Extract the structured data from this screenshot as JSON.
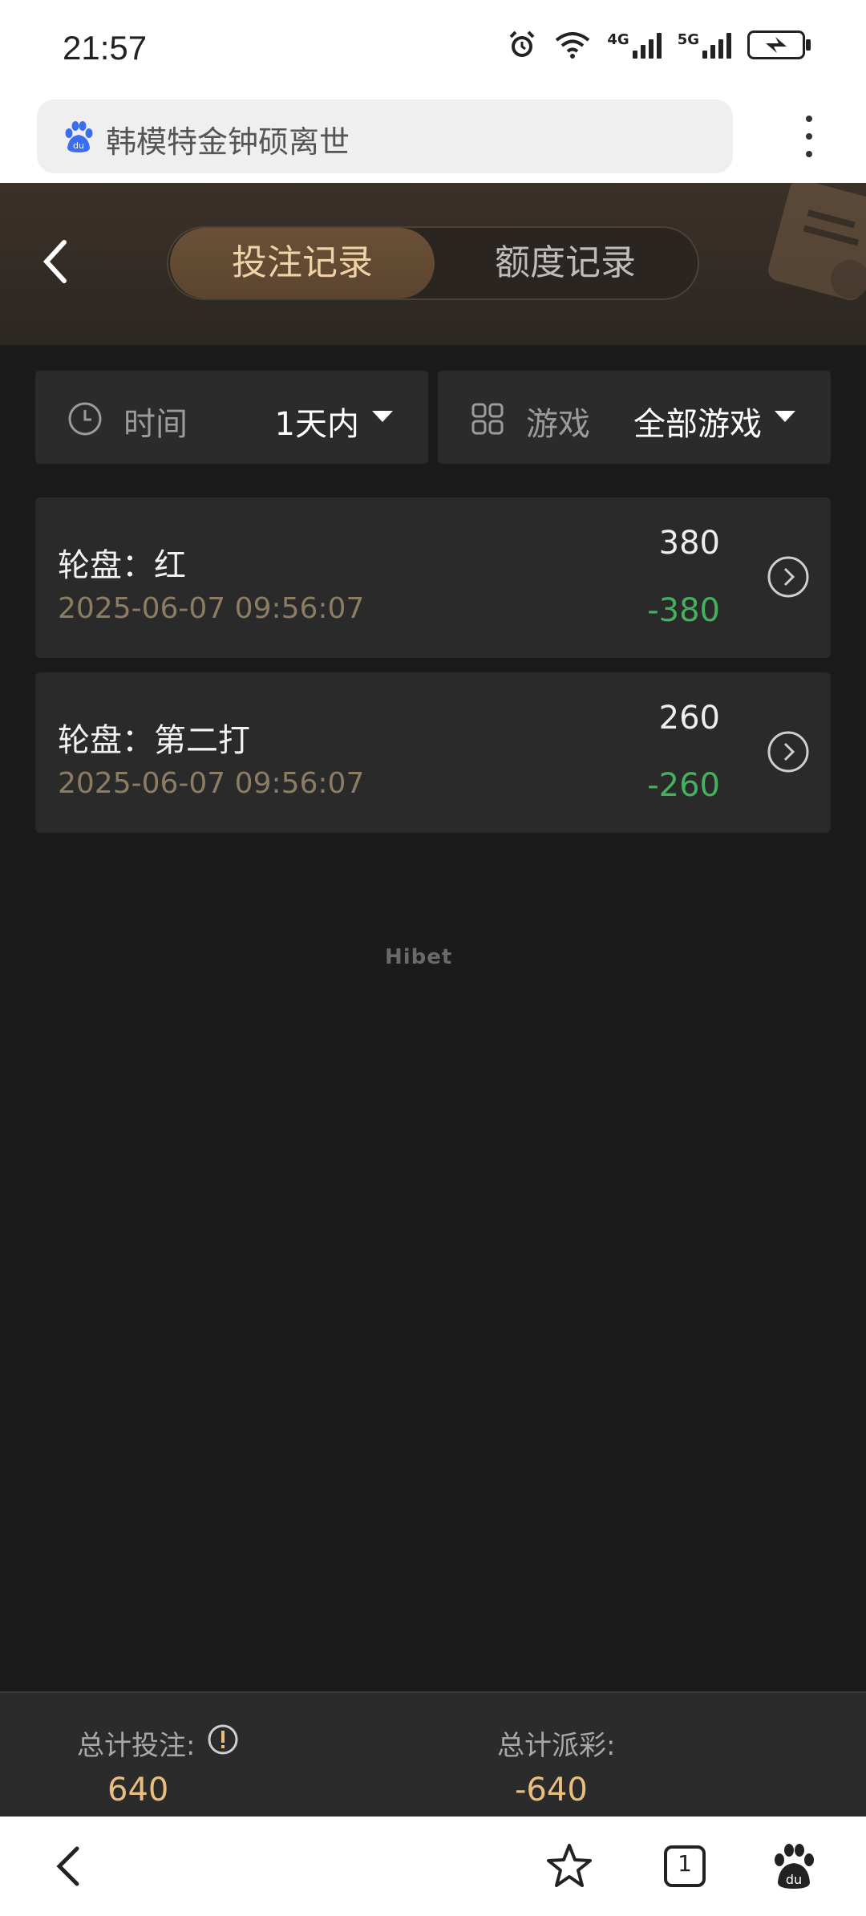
{
  "status_bar": {
    "time": "21:57",
    "net1": "4G",
    "net2": "5G",
    "icons": [
      "alarm-icon",
      "wifi-icon",
      "signal-icon",
      "battery-icon"
    ]
  },
  "browser": {
    "url_text": "韩模特金钟硕离世",
    "logo_text": "du"
  },
  "header": {
    "tabs": [
      {
        "label": "投注记录",
        "active": true
      },
      {
        "label": "额度记录",
        "active": false
      }
    ]
  },
  "filters": {
    "time": {
      "label": "时间",
      "value": "1天内"
    },
    "game": {
      "label": "游戏",
      "value": "全部游戏"
    }
  },
  "records": [
    {
      "title": "轮盘：红",
      "time": "2025-06-07 09:56:07",
      "bet": "380",
      "win": "-380"
    },
    {
      "title": "轮盘：第二打",
      "time": "2025-06-07 09:56:07",
      "bet": "260",
      "win": "-260"
    }
  ],
  "watermark": "Hibet",
  "summary": {
    "total_bet_label": "总计投注:",
    "total_bet_value": "640",
    "total_payout_label": "总计派彩:",
    "total_payout_value": "-640"
  },
  "bottom_nav": {
    "tabs_count": "1"
  },
  "colors": {
    "accent_gold": "#e9be80",
    "loss_green": "#45b05e",
    "background": "#1b1b1b"
  }
}
